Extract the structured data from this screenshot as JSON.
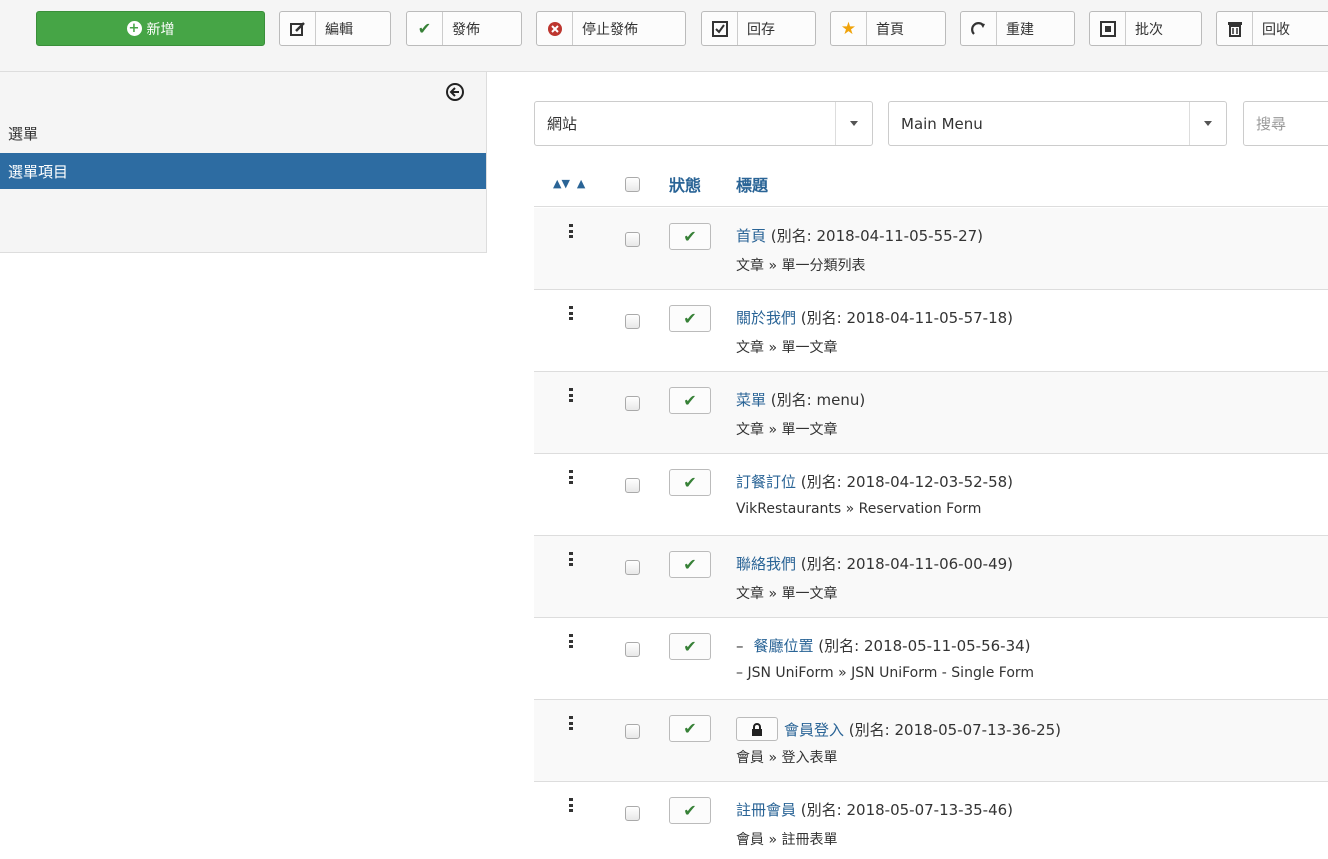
{
  "toolbar": {
    "new": "新增",
    "edit": "編輯",
    "publish": "發佈",
    "unpublish": "停止發佈",
    "checkin": "回存",
    "home": "首頁",
    "rebuild": "重建",
    "batch": "批次",
    "trash": "回收"
  },
  "sidebar": {
    "items": [
      {
        "label": "選單",
        "active": false
      },
      {
        "label": "選單項目",
        "active": true
      }
    ]
  },
  "filters": {
    "client": "網站",
    "menu": "Main Menu",
    "search_placeholder": "搜尋"
  },
  "table": {
    "headers": {
      "status": "狀態",
      "title": "標題"
    },
    "alias_label": "別名:",
    "rows": [
      {
        "title": "首頁",
        "alias": "2018-04-11-05-55-27",
        "type": "文章 » 單一分類列表",
        "level_prefix": "",
        "locked": false
      },
      {
        "title": "關於我們",
        "alias": "2018-04-11-05-57-18",
        "type": "文章 » 單一文章",
        "level_prefix": "",
        "locked": false
      },
      {
        "title": "菜單",
        "alias": "menu",
        "type": "文章 » 單一文章",
        "level_prefix": "",
        "locked": false
      },
      {
        "title": "訂餐訂位",
        "alias": "2018-04-12-03-52-58",
        "type": "VikRestaurants » Reservation Form",
        "level_prefix": "",
        "locked": false
      },
      {
        "title": "聯絡我們",
        "alias": "2018-04-11-06-00-49",
        "type": "文章 » 單一文章",
        "level_prefix": "",
        "locked": false
      },
      {
        "title": "餐廳位置",
        "alias": "2018-05-11-05-56-34",
        "type": "– JSN UniForm » JSN UniForm - Single Form",
        "level_prefix": "–",
        "locked": false
      },
      {
        "title": "會員登入",
        "alias": "2018-05-07-13-36-25",
        "type": "會員 » 登入表單",
        "level_prefix": "",
        "locked": true
      },
      {
        "title": "註冊會員",
        "alias": "2018-05-07-13-35-46",
        "type": "會員 » 註冊表單",
        "level_prefix": "",
        "locked": false
      }
    ]
  },
  "colors": {
    "new_button": "#46a546",
    "sidebar_active": "#2d6ca2",
    "link": "#2a6496",
    "check": "#378137",
    "unpublish_icon": "#bd362f",
    "home_star": "#f0a30a"
  }
}
